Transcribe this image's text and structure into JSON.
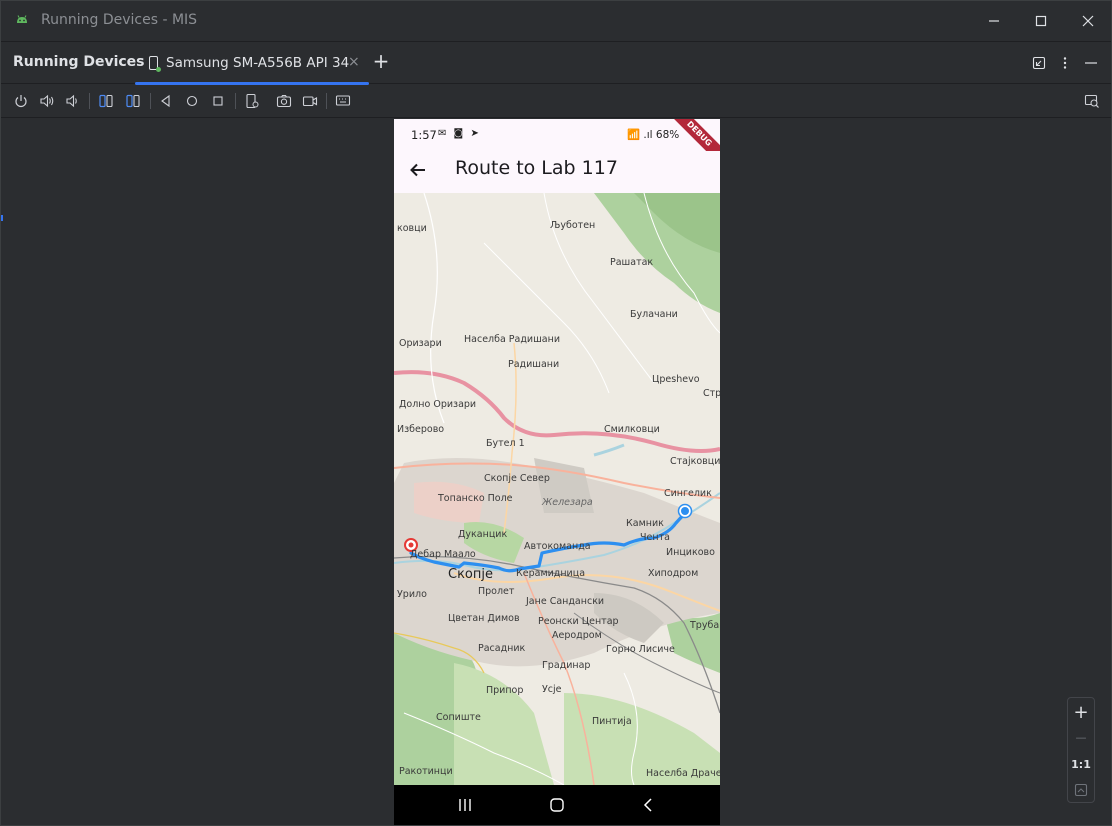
{
  "window": {
    "title": "Running Devices - MIS"
  },
  "tabbar": {
    "tool_title": "Running Devices",
    "device_tab_label": "Samsung SM-A556B API 34",
    "close_symbol": "×",
    "add_symbol": "+"
  },
  "toolbar": {
    "icons": [
      "power-icon",
      "volume-up-icon",
      "volume-down-icon",
      "rotate-left-icon",
      "rotate-right-icon",
      "back-icon",
      "home-icon",
      "overview-icon",
      "device-settings-icon",
      "screenshot-icon",
      "screen-record-icon",
      "keyboard-icon",
      "layout-inspector-icon"
    ]
  },
  "phone": {
    "status": {
      "time": "1:57",
      "notifications": "✉ ◙ ➤",
      "right_text": "📶 .ıl 68%",
      "debug": "DEBUG"
    },
    "appbar": {
      "title": "Route to Lab 117"
    },
    "map_labels": [
      "Љуботен",
      "Рашатак",
      "Булачани",
      "Населба Радишани",
      "Радишани",
      "Цреshevo",
      "Долно Оризари",
      "Бутел 1",
      "Смилковци",
      "Стајковци",
      "Скопје Север",
      "Топанско Поле",
      "Железара",
      "Сингелик",
      "Камник",
      "Чента",
      "Инциково",
      "Дуканцик",
      "Автокоманда",
      "Дебар Маало",
      "Скопје",
      "Керамидница",
      "Хиподром",
      "Пролет",
      "Јане Сандански",
      "Цветан Димов",
      "Реонски Центар",
      "Аеродром",
      "Горно Лисиче",
      "Расадник",
      "Градинар",
      "Припор",
      "Усје",
      "Сопиште",
      "Пинтија",
      "Ракотинци",
      "Населба Драчево",
      "Трубар",
      "Оризари",
      "Изберово",
      "Урило",
      "ковци",
      "Стр"
    ]
  },
  "zoom_panel": {
    "plus": "+",
    "minus": "—",
    "one_to_one": "1:1"
  },
  "colors": {
    "accent": "#3574f0",
    "route": "#2d8ff0",
    "debug_ribbon": "#b3283a",
    "appbar_bg": "#fdf7fd"
  }
}
